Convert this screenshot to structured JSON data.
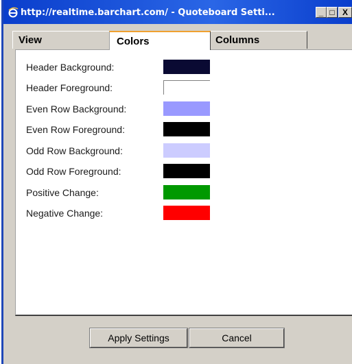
{
  "window": {
    "title": "http://realtime.barchart.com/ - Quoteboard Setti...",
    "controls": {
      "minimize": "_",
      "maximize": "□",
      "close": "X"
    }
  },
  "tabs": [
    {
      "label": "View",
      "active": false
    },
    {
      "label": "Colors",
      "active": true
    },
    {
      "label": "Columns",
      "active": false
    }
  ],
  "colors": [
    {
      "label": "Header Background:",
      "color": "#0a0a33"
    },
    {
      "label": "Header Foreground:",
      "color": "#ffffff"
    },
    {
      "label": "Even Row Background:",
      "color": "#9999ff"
    },
    {
      "label": "Even Row Foreground:",
      "color": "#000000"
    },
    {
      "label": "Odd Row Background:",
      "color": "#ccccff"
    },
    {
      "label": "Odd Row Foreground:",
      "color": "#000000"
    },
    {
      "label": "Positive Change:",
      "color": "#009900"
    },
    {
      "label": "Negative Change:",
      "color": "#ff0000"
    }
  ],
  "buttons": {
    "apply": "Apply Settings",
    "cancel": "Cancel"
  }
}
